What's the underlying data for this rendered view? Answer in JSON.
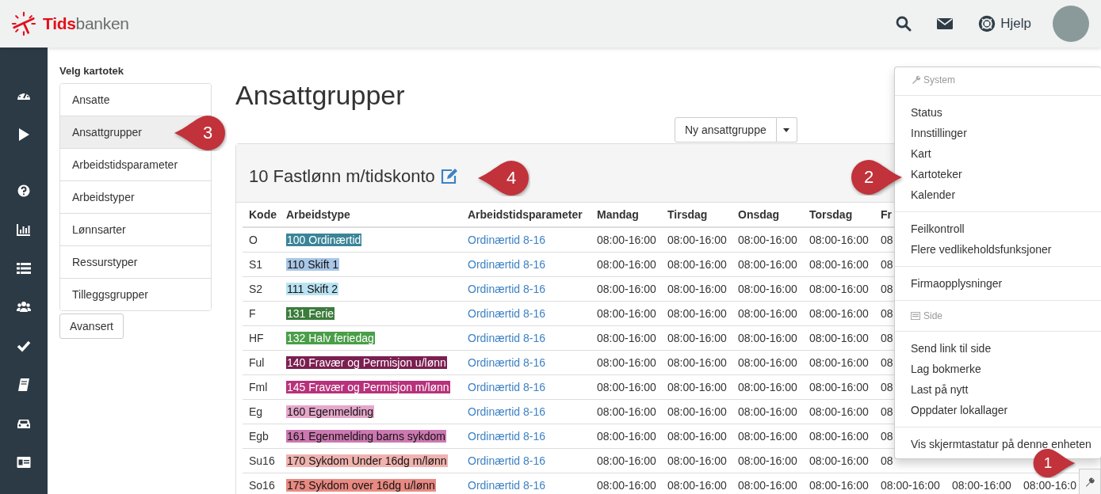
{
  "header": {
    "logo": {
      "part_1": "Tids",
      "part_2": "banken"
    },
    "help_label": "Hjelp"
  },
  "catalog_nav": {
    "title": "Velg kartotek",
    "items": [
      {
        "label": "Ansatte",
        "selected": false
      },
      {
        "label": "Ansattgrupper",
        "selected": true
      },
      {
        "label": "Arbeidstidsparameter",
        "selected": false
      },
      {
        "label": "Arbeidstyper",
        "selected": false
      },
      {
        "label": "Lønnsarter",
        "selected": false
      },
      {
        "label": "Ressurstyper",
        "selected": false
      },
      {
        "label": "Tilleggsgrupper",
        "selected": false
      }
    ],
    "advanced_button": "Avansert"
  },
  "page_title": "Ansattgrupper",
  "new_button": "Ny ansattgruppe",
  "panel": {
    "title": "10 Fastlønn m/tidskonto",
    "table": {
      "columns": [
        "Kode",
        "Arbeidstype",
        "Arbeidstidsparameter",
        "Mandag",
        "Tirsdag",
        "Onsdag",
        "Torsdag",
        "Fr"
      ],
      "rows": [
        {
          "code": "O",
          "work_type": "100 Ordinærtid",
          "color": "#3a8497",
          "parameter": "Ordinærtid 8-16",
          "days": [
            "08:00-16:00",
            "08:00-16:00",
            "08:00-16:00",
            "08:00-16:00",
            "08"
          ]
        },
        {
          "code": "S1",
          "work_type": "110 Skift 1",
          "color": "#a9c7e6",
          "parameter": "Ordinærtid 8-16",
          "days": [
            "08:00-16:00",
            "08:00-16:00",
            "08:00-16:00",
            "08:00-16:00",
            "08"
          ]
        },
        {
          "code": "S2",
          "work_type": "111 Skift 2",
          "color": "#b9e3f3",
          "parameter": "Ordinærtid 8-16",
          "days": [
            "08:00-16:00",
            "08:00-16:00",
            "08:00-16:00",
            "08:00-16:00",
            "08"
          ]
        },
        {
          "code": "F",
          "work_type": "131 Ferie",
          "color": "#3b7b3b",
          "parameter": "Ordinærtid 8-16",
          "days": [
            "08:00-16:00",
            "08:00-16:00",
            "08:00-16:00",
            "08:00-16:00",
            "08"
          ]
        },
        {
          "code": "HF",
          "work_type": "132 Halv feriedag",
          "color": "#4a9e48",
          "parameter": "Ordinærtid 8-16",
          "days": [
            "08:00-16:00",
            "08:00-16:00",
            "08:00-16:00",
            "08:00-16:00",
            "08"
          ]
        },
        {
          "code": "Ful",
          "work_type": "140 Fravær og Permisjon u/lønn",
          "color": "#7a1f50",
          "parameter": "Ordinærtid 8-16",
          "days": [
            "08:00-16:00",
            "08:00-16:00",
            "08:00-16:00",
            "08:00-16:00",
            "08"
          ]
        },
        {
          "code": "Fml",
          "work_type": "145 Fravær og Permisjon m/lønn",
          "color": "#b7327b",
          "parameter": "Ordinærtid 8-16",
          "days": [
            "08:00-16:00",
            "08:00-16:00",
            "08:00-16:00",
            "08:00-16:00",
            "08"
          ]
        },
        {
          "code": "Eg",
          "work_type": "160 Egenmelding",
          "color": "#e6a7cb",
          "parameter": "Ordinærtid 8-16",
          "days": [
            "08:00-16:00",
            "08:00-16:00",
            "08:00-16:00",
            "08:00-16:00",
            "08"
          ]
        },
        {
          "code": "Egb",
          "work_type": "161 Egenmelding barns sykdom",
          "color": "#cc78b1",
          "parameter": "Ordinærtid 8-16",
          "days": [
            "08:00-16:00",
            "08:00-16:00",
            "08:00-16:00",
            "08:00-16:00",
            "08"
          ]
        },
        {
          "code": "Su16",
          "work_type": "170 Sykdom Under 16dg m/lønn",
          "color": "#f0b3b0",
          "parameter": "Ordinærtid 8-16",
          "days": [
            "08:00-16:00",
            "08:00-16:00",
            "08:00-16:00",
            "08:00-16:00",
            "08"
          ]
        },
        {
          "code": "So16",
          "work_type": "175 Sykdom over 16dg u/lønn",
          "color": "#e88a82",
          "parameter": "Ordinærtid 8-16",
          "days": [
            "08:00-16:00",
            "08:00-16:00",
            "08:00-16:00",
            "08:00-16:00",
            "08:00-16:00",
            "08:00-16:00",
            "08:00-16:0"
          ]
        }
      ]
    }
  },
  "system_menu": {
    "entries": [
      {
        "kind": "header",
        "label": "System"
      },
      {
        "kind": "divider"
      },
      {
        "kind": "item",
        "label": "Status"
      },
      {
        "kind": "item",
        "label": "Innstillinger"
      },
      {
        "kind": "item",
        "label": "Kart"
      },
      {
        "kind": "item",
        "label": "Kartoteker"
      },
      {
        "kind": "item",
        "label": "Kalender"
      },
      {
        "kind": "divider"
      },
      {
        "kind": "item",
        "label": "Feilkontroll"
      },
      {
        "kind": "item",
        "label": "Flere vedlikeholdsfunksjoner"
      },
      {
        "kind": "divider"
      },
      {
        "kind": "item",
        "label": "Firmaopplysninger"
      },
      {
        "kind": "divider"
      },
      {
        "kind": "header",
        "label": "Side"
      },
      {
        "kind": "divider"
      },
      {
        "kind": "item",
        "label": "Send link til side"
      },
      {
        "kind": "item",
        "label": "Lag bokmerke"
      },
      {
        "kind": "item",
        "label": "Last på nytt"
      },
      {
        "kind": "item",
        "label": "Oppdater lokallager"
      },
      {
        "kind": "divider"
      },
      {
        "kind": "item",
        "label": "Vis skjermtastatur på denne enheten"
      }
    ]
  },
  "callouts": [
    {
      "number": "3"
    },
    {
      "number": "4"
    },
    {
      "number": "2"
    },
    {
      "number": "1"
    }
  ]
}
